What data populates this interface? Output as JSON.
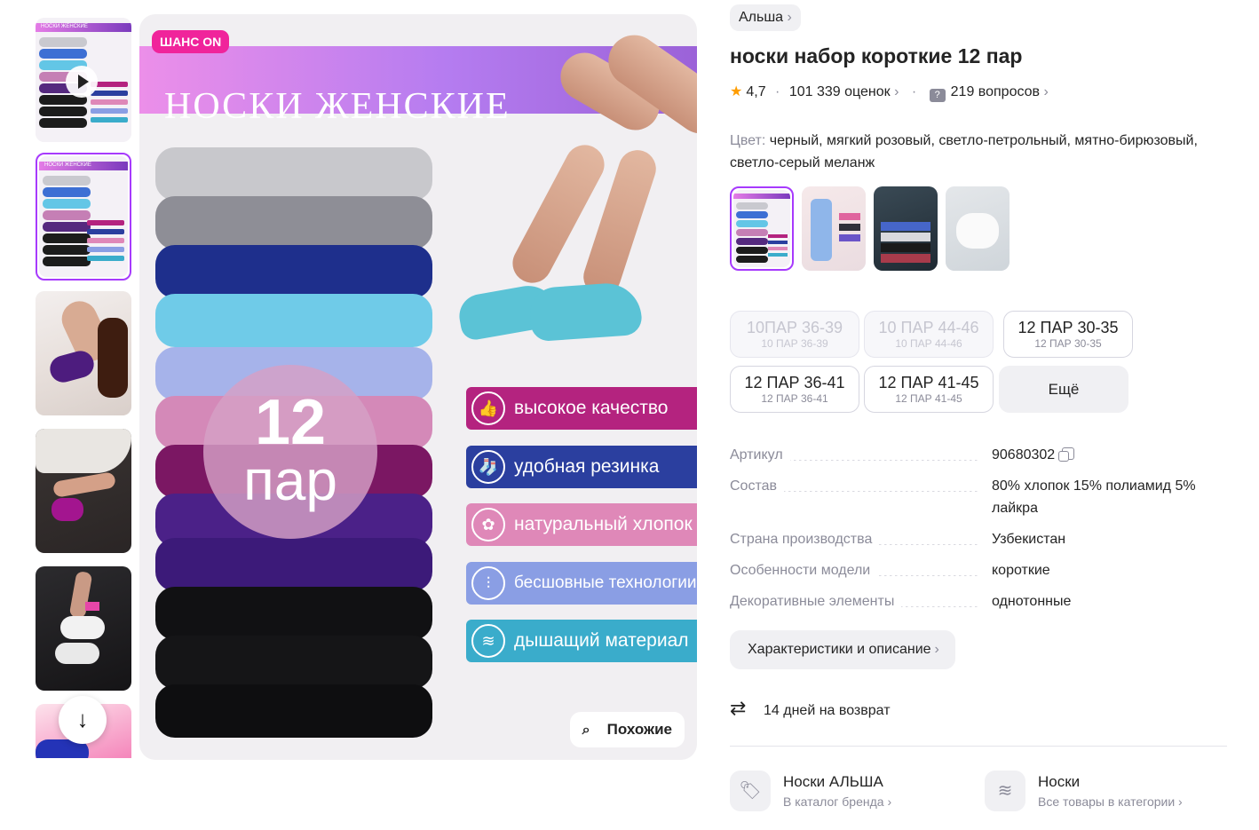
{
  "gallery": {
    "ad_badge": "ШАНС ON",
    "ad_title": "НОСКИ ЖЕНСКИЕ",
    "count_number": "12",
    "count_unit": "пар",
    "features": [
      {
        "label": "высокое качество",
        "icon": "thumbs-up-icon",
        "color": "#b4237f"
      },
      {
        "label": "удобная резинка",
        "icon": "sock-icon",
        "color": "#2b3f9f"
      },
      {
        "label": "натуральный хлопок",
        "icon": "cotton-icon",
        "color": "#df88b8"
      },
      {
        "label": "бесшовные технологии",
        "icon": "seamless-icon",
        "color": "#8a9ee4"
      },
      {
        "label": "дышащий материал",
        "icon": "breathable-icon",
        "color": "#3aaccb"
      }
    ],
    "similar_label": "Похожие",
    "mini_ad_title": "НОСКИ ЖЕНСКИЕ",
    "mini_count": "12\nпар"
  },
  "product": {
    "brand": "Альша",
    "title": "носки набор короткие 12 пар",
    "rating": "4,7",
    "reviews": "101 339 оценок",
    "questions": "219 вопросов",
    "color_label": "Цвет:",
    "color_value": "черный, мягкий розовый, светло-петрольный, мятно-бирюзовый, светло-серый меланж"
  },
  "sizes": [
    {
      "main": "10ПАР 36-39",
      "sub": "10 ПАР 36-39",
      "available": false
    },
    {
      "main": "10 ПАР 44-46",
      "sub": "10 ПАР 44-46",
      "available": false
    },
    {
      "main": "12 ПАР 30-35",
      "sub": "12 ПАР 30-35",
      "available": true
    },
    {
      "main": "12 ПАР 36-41",
      "sub": "12 ПАР 36-41",
      "available": true
    },
    {
      "main": "12 ПАР 41-45",
      "sub": "12 ПАР 41-45",
      "available": true
    }
  ],
  "more_label": "Ещё",
  "specs": [
    {
      "key": "Артикул",
      "value": "90680302"
    },
    {
      "key": "Состав",
      "value": "80% хлопок 15% полиамид 5% лайкра"
    },
    {
      "key": "Страна производства",
      "value": "Узбекистан"
    },
    {
      "key": "Особенности модели",
      "value": "короткие"
    },
    {
      "key": "Декоративные элементы",
      "value": "однотонные"
    }
  ],
  "characteristics_button": "Характеристики и описание",
  "return_text": "14 дней на возврат",
  "brand_card": {
    "title": "Носки АЛЬША",
    "subtitle": "В каталог бренда"
  },
  "category_card": {
    "title": "Носки",
    "subtitle": "Все товары в категории"
  },
  "colors": {
    "accent": "#a73afd",
    "rating_star": "#ff9d00",
    "muted_text": "#8b8b99"
  }
}
